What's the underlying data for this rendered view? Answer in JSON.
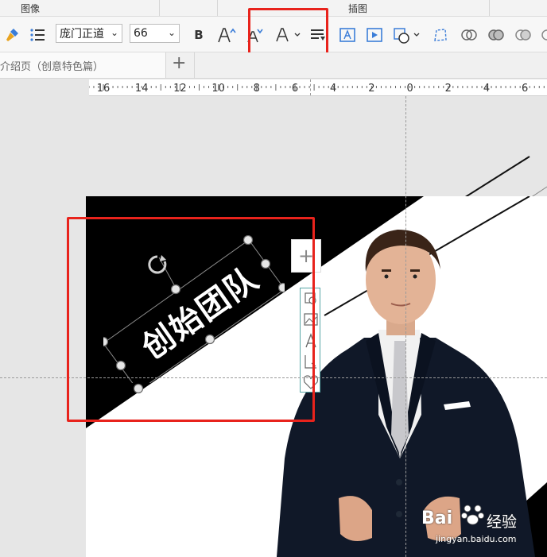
{
  "ribbon_groups": {
    "image": "图像",
    "illustration": "插图"
  },
  "toolbar": {
    "font_name": "庞门正道",
    "font_size": "66",
    "bold_label": "B"
  },
  "tab": {
    "label": "介绍页（创意特色篇）",
    "add": "+"
  },
  "ruler": {
    "ticks": [
      "16",
      "14",
      "12",
      "10",
      "8",
      "6",
      "4",
      "2",
      "0",
      "2",
      "4",
      "6"
    ]
  },
  "slide": {
    "title_text": "创始团队"
  },
  "float_toolbar": {
    "add": "+"
  },
  "watermark": {
    "brand": "Bai",
    "brand2": "经验",
    "url": "jingyan.baidu.com"
  },
  "colors": {
    "highlight": "#e8231c",
    "slide_black": "#000000",
    "accent_selection": "#8a8a8a"
  }
}
